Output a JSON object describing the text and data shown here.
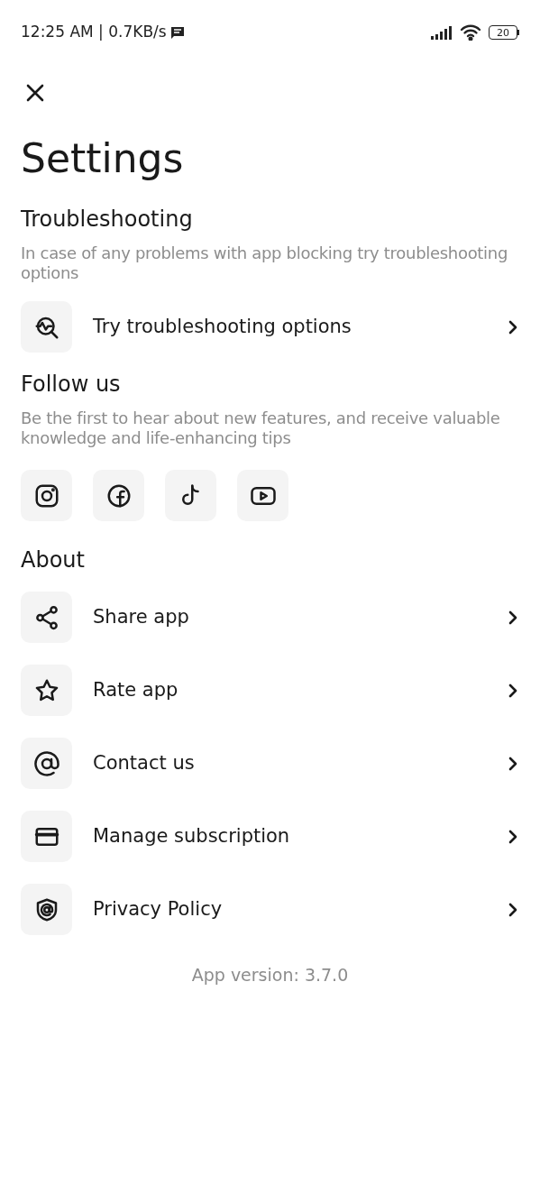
{
  "status_bar": {
    "time": "12:25 AM | 0.7KB/s",
    "battery": "20"
  },
  "title": "Settings",
  "sections": [
    {
      "kind": "list",
      "heading": "Troubleshooting",
      "description": "In case of any problems with app blocking try troubleshooting options",
      "items": [
        {
          "label": "Try troubleshooting options"
        }
      ]
    },
    {
      "kind": "social",
      "heading": "Follow us",
      "description": "Be the first to hear about new features, and receive valuable knowledge and life-enhancing tips"
    },
    {
      "kind": "list",
      "heading": "About",
      "items": [
        {
          "label": "Share app"
        },
        {
          "label": "Rate app"
        },
        {
          "label": "Contact us"
        },
        {
          "label": "Manage subscription"
        },
        {
          "label": "Privacy Policy"
        }
      ]
    }
  ],
  "footer": "App version: 3.7.0"
}
